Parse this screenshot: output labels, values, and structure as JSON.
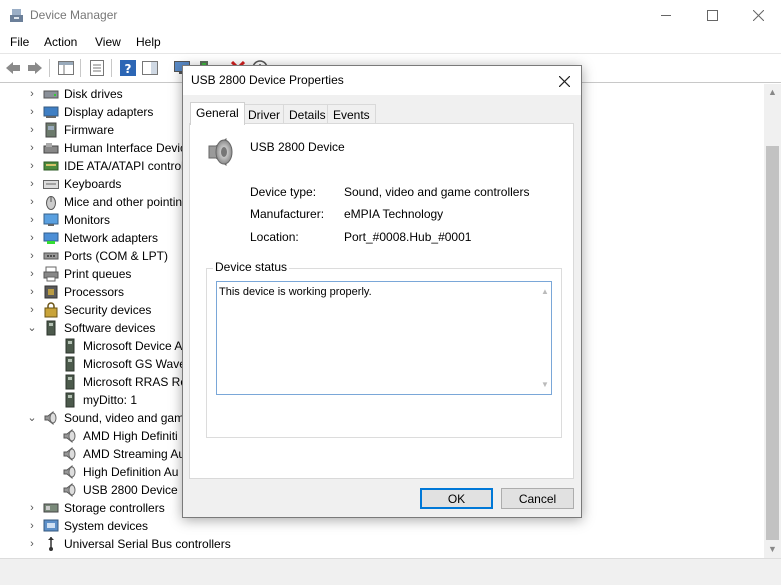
{
  "window": {
    "title": "Device Manager",
    "icon": "device-manager-icon"
  },
  "menu": [
    "File",
    "Action",
    "View",
    "Help"
  ],
  "tree": [
    {
      "label": "Disk drives",
      "expanded": false,
      "icon": "disk-drive-icon"
    },
    {
      "label": "Display adapters",
      "expanded": false,
      "icon": "display-adapter-icon"
    },
    {
      "label": "Firmware",
      "expanded": false,
      "icon": "firmware-icon"
    },
    {
      "label": "Human Interface Devic",
      "expanded": false,
      "icon": "hid-icon"
    },
    {
      "label": "IDE ATA/ATAPI controll",
      "expanded": false,
      "icon": "ide-controller-icon"
    },
    {
      "label": "Keyboards",
      "expanded": false,
      "icon": "keyboard-icon"
    },
    {
      "label": "Mice and other pointin",
      "expanded": false,
      "icon": "mouse-icon"
    },
    {
      "label": "Monitors",
      "expanded": false,
      "icon": "monitor-icon"
    },
    {
      "label": "Network adapters",
      "expanded": false,
      "icon": "network-adapter-icon"
    },
    {
      "label": "Ports (COM & LPT)",
      "expanded": false,
      "icon": "port-icon"
    },
    {
      "label": "Print queues",
      "expanded": false,
      "icon": "printer-icon"
    },
    {
      "label": "Processors",
      "expanded": false,
      "icon": "processor-icon"
    },
    {
      "label": "Security devices",
      "expanded": false,
      "icon": "security-device-icon"
    },
    {
      "label": "Software devices",
      "expanded": true,
      "icon": "software-device-icon"
    },
    {
      "label": "Microsoft Device A",
      "child": true,
      "icon": "software-device-icon"
    },
    {
      "label": "Microsoft GS Wave",
      "child": true,
      "icon": "software-device-icon"
    },
    {
      "label": "Microsoft RRAS Ro",
      "child": true,
      "icon": "software-device-icon"
    },
    {
      "label": "myDitto: 1",
      "child": true,
      "icon": "software-device-icon"
    },
    {
      "label": "Sound, video and gam",
      "expanded": true,
      "icon": "speaker-icon"
    },
    {
      "label": "AMD High Definiti",
      "child": true,
      "icon": "speaker-icon"
    },
    {
      "label": "AMD Streaming Au",
      "child": true,
      "icon": "speaker-icon"
    },
    {
      "label": "High Definition Au",
      "child": true,
      "icon": "speaker-icon"
    },
    {
      "label": "USB 2800 Device",
      "child": true,
      "icon": "speaker-icon"
    },
    {
      "label": "Storage controllers",
      "expanded": false,
      "icon": "storage-controller-icon"
    },
    {
      "label": "System devices",
      "expanded": false,
      "icon": "system-device-icon"
    },
    {
      "label": "Universal Serial Bus controllers",
      "expanded": false,
      "icon": "usb-icon"
    }
  ],
  "dialog": {
    "title": "USB 2800 Device Properties",
    "tabs": [
      "General",
      "Driver",
      "Details",
      "Events"
    ],
    "active_tab": "General",
    "device_name": "USB 2800 Device",
    "properties": [
      {
        "label": "Device type:",
        "value": "Sound, video and game controllers"
      },
      {
        "label": "Manufacturer:",
        "value": "eMPIA Technology"
      },
      {
        "label": "Location:",
        "value": "Port_#0008.Hub_#0001"
      }
    ],
    "status_group_label": "Device status",
    "status_text": "This device is working properly.",
    "ok_label": "OK",
    "cancel_label": "Cancel"
  },
  "colors": {
    "accent": "#0078d7",
    "dialog_bg": "#f0f0f0"
  }
}
